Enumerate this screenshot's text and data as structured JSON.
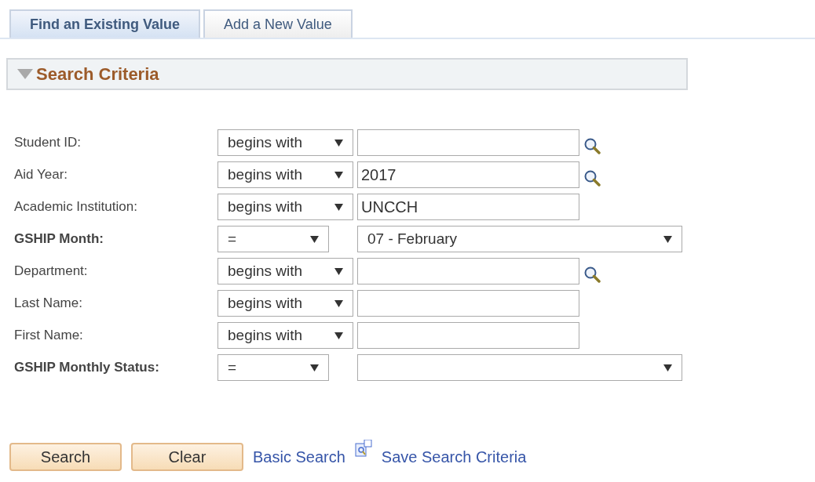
{
  "tabs": [
    {
      "label": "Find an Existing Value",
      "selected": true
    },
    {
      "label": "Add a New Value",
      "selected": false
    }
  ],
  "section": {
    "title": "Search Criteria",
    "expanded": true
  },
  "fields": [
    {
      "kind": "text",
      "label": "Student ID:",
      "required": false,
      "operator": "begins with",
      "lookup": true
    },
    {
      "kind": "text",
      "label": "Aid Year:",
      "required": false,
      "operator": "begins with",
      "value": "2017",
      "lookup": true
    },
    {
      "kind": "text",
      "label": "Academic Institution:",
      "required": false,
      "operator": "begins with",
      "value": "UNCCH",
      "lookup": false
    },
    {
      "kind": "select",
      "label": "GSHIP Month:",
      "required": true,
      "operator": "=",
      "value": "07 - February"
    },
    {
      "kind": "text",
      "label": "Department:",
      "required": false,
      "operator": "begins with",
      "lookup": true
    },
    {
      "kind": "text",
      "label": "Last Name:",
      "required": false,
      "operator": "begins with",
      "lookup": false
    },
    {
      "kind": "text",
      "label": "First Name:",
      "required": false,
      "operator": "begins with",
      "lookup": false
    },
    {
      "kind": "select",
      "label": "GSHIP Monthly Status:",
      "required": true,
      "operator": "="
    }
  ],
  "buttons": [
    "Search",
    "Clear"
  ],
  "links": [
    {
      "label": "Basic Search"
    },
    {
      "label": "Save Search Criteria"
    }
  ]
}
